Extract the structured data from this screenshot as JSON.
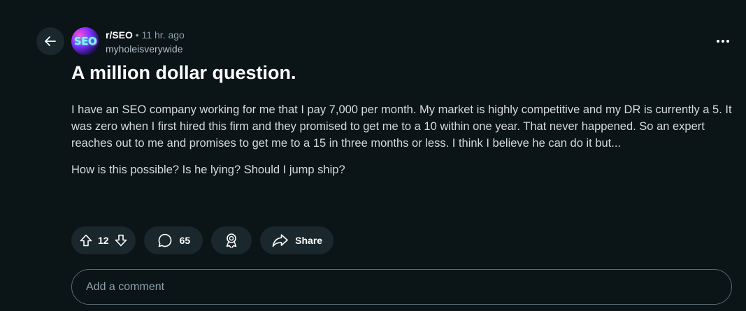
{
  "post": {
    "subreddit": "r/SEO",
    "separator": "•",
    "age": "11 hr. ago",
    "username": "myholeisverywide",
    "avatar_text": "SEO",
    "title": "A million dollar question.",
    "paragraphs": [
      "I have an SEO company working for me that I pay 7,000 per month. My market is highly competitive and my DR is currently a 5. It was zero when I first hired this firm and they promised to get me to a 10 within one year. That never happened. So an expert reaches out to me and promises to get me to a 15 in three months or less. I think I believe he can do it but...",
      "How is this possible? Is he lying? Should I jump ship?"
    ]
  },
  "actions": {
    "vote_count": "12",
    "comment_count": "65",
    "share_label": "Share"
  },
  "comment_box": {
    "placeholder": "Add a comment"
  },
  "icons": {
    "back": "arrow-left-icon",
    "more": "more-horizontal-icon",
    "upvote": "arrow-up-icon",
    "downvote": "arrow-down-icon",
    "comment": "comment-bubble-icon",
    "award": "award-icon",
    "share": "share-arrow-icon"
  },
  "colors": {
    "background": "#0b1416",
    "pill": "#1a282d",
    "text": "#d7dadc",
    "muted": "#8ba2ad"
  }
}
